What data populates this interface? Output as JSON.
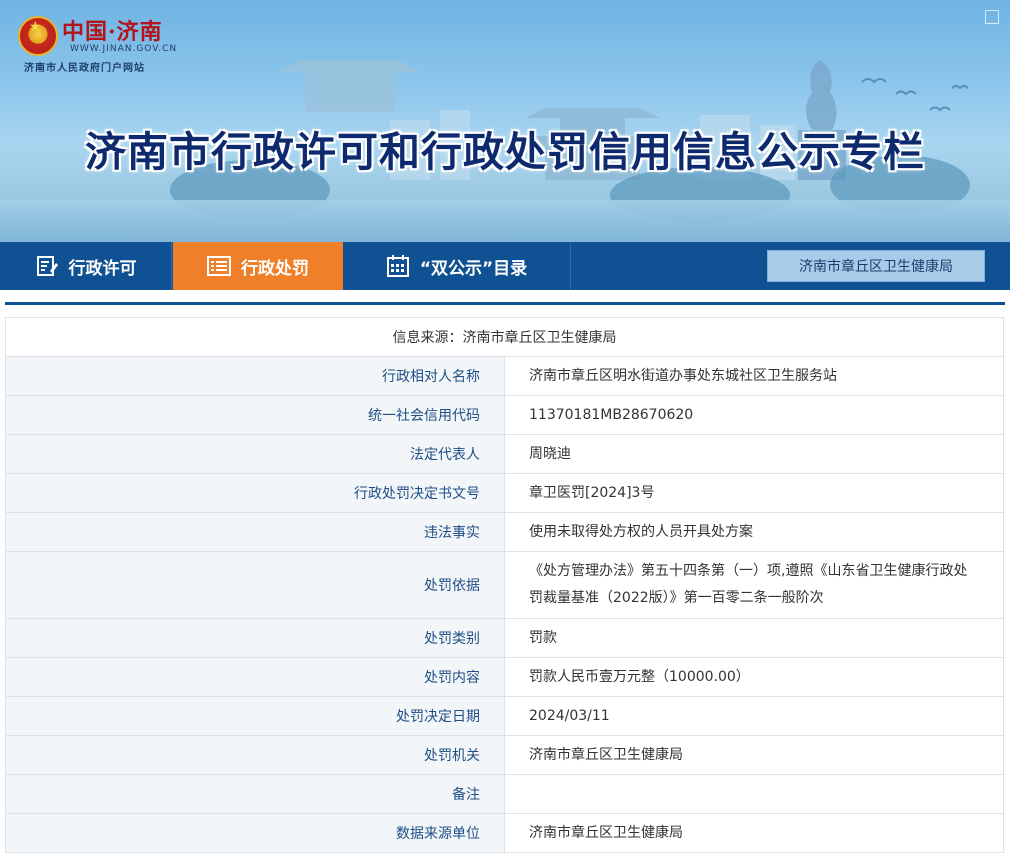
{
  "header": {
    "site_name": "中国·济南",
    "site_url": "WWW.JINAN.GOV.CN",
    "site_subtitle": "济南市人民政府门户网站",
    "banner_title": "济南市行政许可和行政处罚信用信息公示专栏"
  },
  "nav": {
    "tabs": [
      {
        "label": "行政许可",
        "icon": "document-edit-icon"
      },
      {
        "label": "行政处罚",
        "icon": "list-icon",
        "active": true
      },
      {
        "label": "“双公示”目录",
        "icon": "calendar-icon"
      }
    ],
    "department": "济南市章丘区卫生健康局"
  },
  "record": {
    "source_label": "信息来源：济南市章丘区卫生健康局",
    "fields": [
      {
        "label": "行政相对人名称",
        "value": "济南市章丘区明水街道办事处东城社区卫生服务站"
      },
      {
        "label": "统一社会信用代码",
        "value": "11370181MB28670620"
      },
      {
        "label": "法定代表人",
        "value": "周晓迪"
      },
      {
        "label": "行政处罚决定书文号",
        "value": "章卫医罚[2024]3号"
      },
      {
        "label": "违法事实",
        "value": "使用未取得处方权的人员开具处方案"
      },
      {
        "label": "处罚依据",
        "value": "《处方管理办法》第五十四条第（一）项,遵照《山东省卫生健康行政处罚裁量基准（2022版）》第一百零二条一般阶次"
      },
      {
        "label": "处罚类别",
        "value": "罚款"
      },
      {
        "label": "处罚内容",
        "value": "罚款人民币壹万元整（10000.00）"
      },
      {
        "label": "处罚决定日期",
        "value": "2024/03/11"
      },
      {
        "label": "处罚机关",
        "value": "济南市章丘区卫生健康局"
      },
      {
        "label": "备注",
        "value": ""
      },
      {
        "label": "数据来源单位",
        "value": "济南市章丘区卫生健康局"
      }
    ]
  },
  "colors": {
    "nav_bg": "#0f5192",
    "nav_active": "#f07f2a",
    "label_text": "#1f4e86",
    "title_text": "#0e2a6e"
  }
}
